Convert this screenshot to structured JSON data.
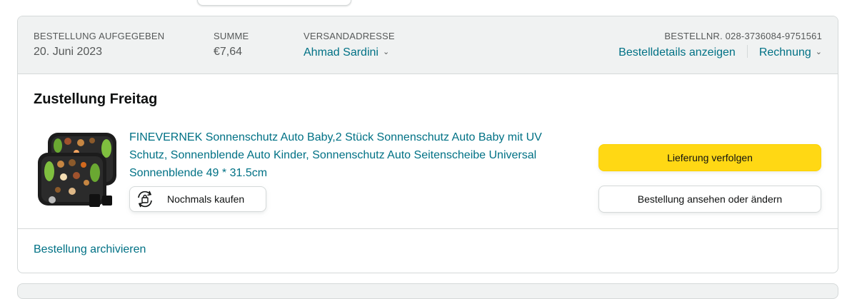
{
  "order": {
    "placed_label": "BESTELLUNG AUFGEGEBEN",
    "placed_value": "20. Juni 2023",
    "total_label": "SUMME",
    "total_value": "€7,64",
    "ship_label": "VERSANDADRESSE",
    "ship_value": "Ahmad Sardini",
    "number_label": "BESTELLNR. 028-3736084-9751561",
    "details_link": "Bestelldetails anzeigen",
    "invoice_link": "Rechnung"
  },
  "shipment": {
    "title": "Zustellung Freitag",
    "track_button": "Lieferung verfolgen",
    "view_button": "Bestellung ansehen oder ändern"
  },
  "product": {
    "title": "FINEVERNEK Sonnenschutz Auto Baby,2 Stück Sonnenschutz Auto Baby mit UV Schutz, Sonnenblende Auto Kinder, Sonnenschutz Auto Seitenscheibe Universal Sonnenblende 49 * 31.5cm",
    "buy_again": "Nochmals kaufen",
    "image_icon": "car-sunshade-product-image"
  },
  "footer": {
    "archive_link": "Bestellung archivieren"
  },
  "icons": {
    "chevron": "chevron-down-icon",
    "buy_again": "buy-again-cycle-icon"
  },
  "colors": {
    "link": "#007185",
    "primary_button": "#ffd814",
    "header_bg": "#f0f2f2",
    "border": "#d5d9d9"
  }
}
